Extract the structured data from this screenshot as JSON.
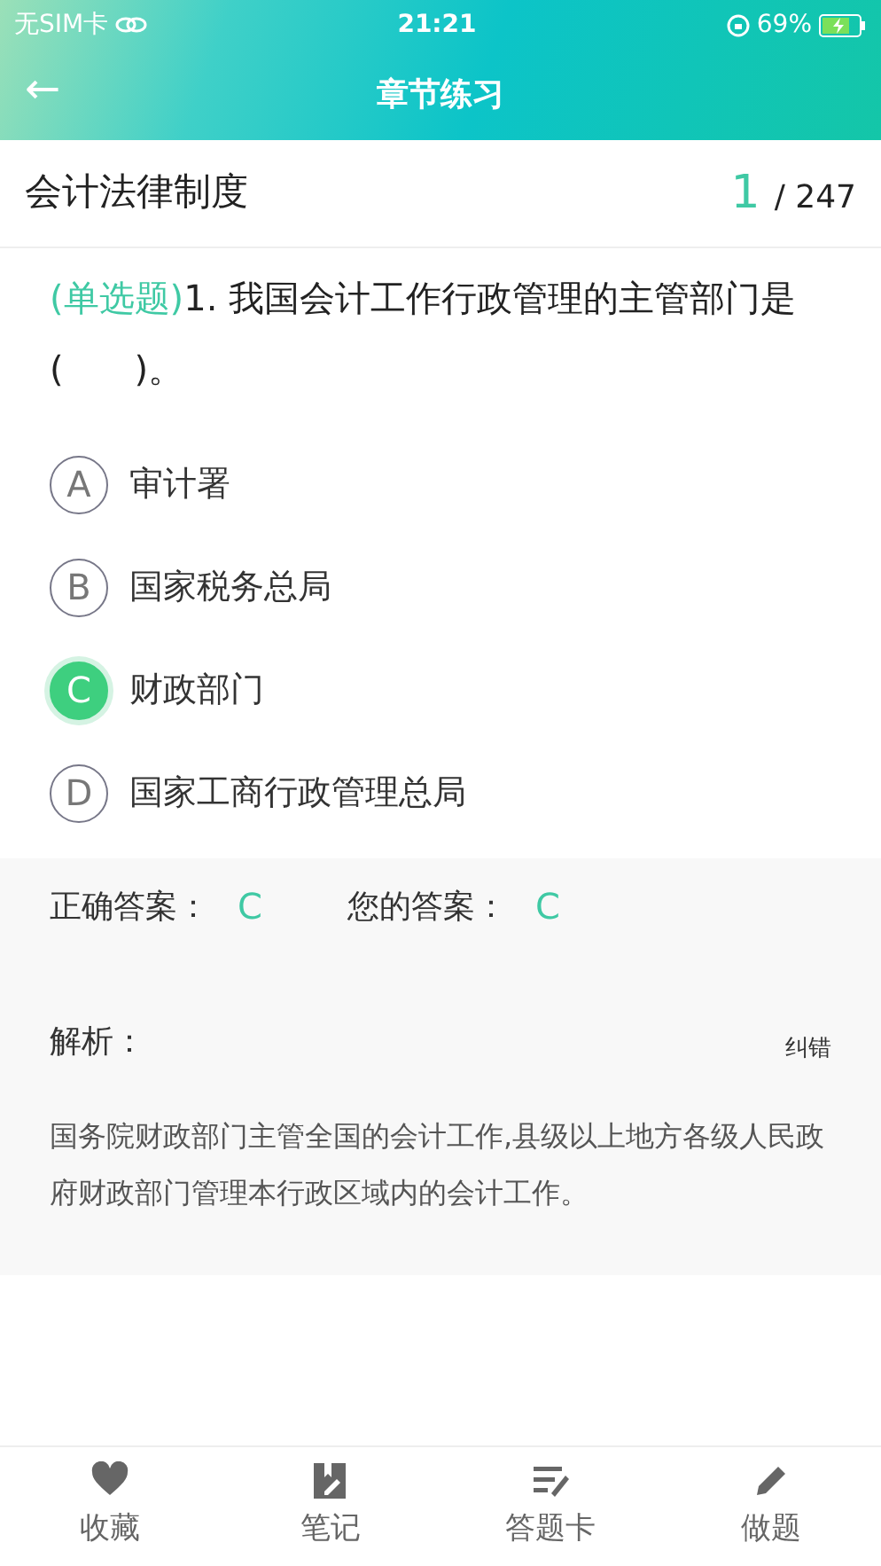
{
  "status_bar": {
    "carrier": "无SIM卡",
    "time": "21:21",
    "battery": "69%"
  },
  "header": {
    "back": "←",
    "title": "章节练习"
  },
  "subject": {
    "name": "会计法律制度",
    "current": "1",
    "total": "/ 247"
  },
  "question": {
    "type": "(单选题)",
    "text": "1. 我国会计工作行政管理的主管部门是(　　)。"
  },
  "options": [
    {
      "letter": "A",
      "text": "审计署",
      "selected": false
    },
    {
      "letter": "B",
      "text": "国家税务总局",
      "selected": false
    },
    {
      "letter": "C",
      "text": "财政部门",
      "selected": true
    },
    {
      "letter": "D",
      "text": "国家工商行政管理总局",
      "selected": false
    }
  ],
  "answer": {
    "correct_label": "正确答案：",
    "correct": "C",
    "yours_label": "您的答案：",
    "yours": "C",
    "analysis_label": "解析：",
    "report": "纠错",
    "analysis": "国务院财政部门主管全国的会计工作,县级以上地方各级人民政府财政部门管理本行政区域内的会计工作。"
  },
  "tabbar": [
    {
      "kind": "heart",
      "label": "收藏"
    },
    {
      "kind": "note",
      "label": "笔记"
    },
    {
      "kind": "card",
      "label": "答题卡"
    },
    {
      "kind": "pencil",
      "label": "做题"
    }
  ]
}
